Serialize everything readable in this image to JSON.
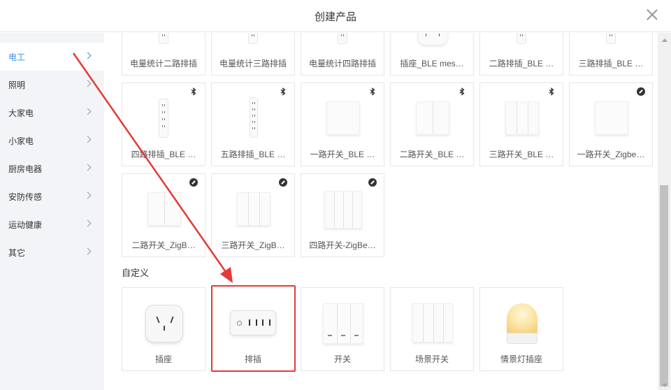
{
  "header": {
    "title": "创建产品"
  },
  "sidebar": {
    "items": [
      {
        "label": "电工",
        "active": true
      },
      {
        "label": "照明",
        "active": false
      },
      {
        "label": "大家电",
        "active": false
      },
      {
        "label": "小家电",
        "active": false
      },
      {
        "label": "厨房电器",
        "active": false
      },
      {
        "label": "安防传感",
        "active": false
      },
      {
        "label": "运动健康",
        "active": false
      },
      {
        "label": "其它",
        "active": false
      }
    ]
  },
  "products": {
    "row1": [
      "电量统计二路排插",
      "电量统计三路排插",
      "电量统计四路排插",
      "插座_BLE mes…",
      "二路排插_BLE …",
      "三路排插_BLE …"
    ],
    "row2": [
      {
        "label": "四路排插_BLE …",
        "badge": "bluetooth-icon"
      },
      {
        "label": "五路排插_BLE …",
        "badge": "bluetooth-icon"
      },
      {
        "label": "一路开关_BLE …",
        "badge": "bluetooth-icon"
      },
      {
        "label": "二路开关_BLE …",
        "badge": "bluetooth-icon"
      },
      {
        "label": "三路开关_BLE …",
        "badge": "bluetooth-icon"
      },
      {
        "label": "一路开关_Zigbe…",
        "badge": "zigbee-icon"
      }
    ],
    "row3": [
      {
        "label": "二路开关_ZigB…",
        "badge": "zigbee-icon"
      },
      {
        "label": "三路开关_ZigB…",
        "badge": "zigbee-icon"
      },
      {
        "label": "四路开关-ZigBe…",
        "badge": "zigbee-icon"
      }
    ]
  },
  "custom": {
    "title": "自定义",
    "items": [
      "插座",
      "排插",
      "开关",
      "场景开关",
      "情景灯插座"
    ]
  },
  "colors": {
    "accent": "#3a8ee6",
    "annotation": "#e53935"
  }
}
